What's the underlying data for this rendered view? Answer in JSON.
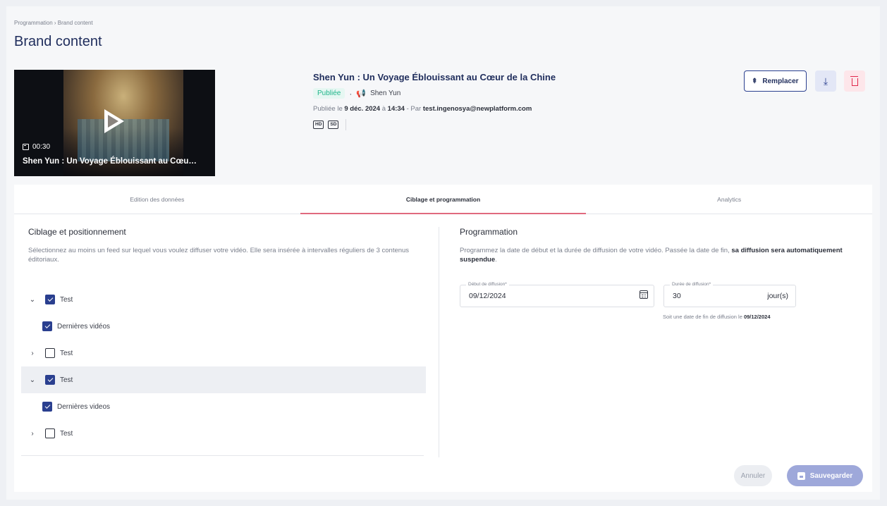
{
  "breadcrumb": "Programmation › Brand content",
  "page_title": "Brand content",
  "thumbnail": {
    "duration": "00:30",
    "title": "Shen Yun : Un Voyage Éblouissant au Cœu…"
  },
  "video": {
    "title": "Shen Yun : Un Voyage Éblouissant au Cœur de la Chine",
    "status": "Publiée",
    "separator": "·",
    "channel": "Shen Yun",
    "published_prefix": "Publiée le ",
    "published_date": "9 déc. 2024",
    "published_mid": " à ",
    "published_time": "14:34",
    "published_by_prefix": " - Par ",
    "published_by": "test.ingenosya@newplatform.com",
    "formats": [
      "HD",
      "SD"
    ]
  },
  "actions": {
    "replace_label": "Remplacer",
    "download_icon": "download-icon",
    "delete_icon": "trash-icon"
  },
  "tabs": [
    {
      "label": "Edition des données",
      "active": false
    },
    {
      "label": "Ciblage et programmation",
      "active": true
    },
    {
      "label": "Analytics",
      "active": false
    }
  ],
  "targeting": {
    "title": "Ciblage et positionnement",
    "description": "Sélectionnez au moins un feed sur lequel vous voulez diffuser votre vidéo. Elle sera insérée à intervalles réguliers de 3 contenus éditoriaux.",
    "tree": [
      {
        "label": "Test",
        "checked": true,
        "expanded": true,
        "level": 0,
        "chevron": "⌄"
      },
      {
        "label": "Dernières vidéos",
        "checked": true,
        "level": 1
      },
      {
        "label": "Test",
        "checked": false,
        "expanded": false,
        "level": 0,
        "chevron": "›"
      },
      {
        "label": "Test",
        "checked": true,
        "expanded": true,
        "level": 0,
        "chevron": "⌄",
        "highlight": true
      },
      {
        "label": "Dernières videos",
        "checked": true,
        "level": 1
      },
      {
        "label": "Test",
        "checked": false,
        "expanded": false,
        "level": 0,
        "chevron": "›"
      }
    ]
  },
  "scheduling": {
    "title": "Programmation",
    "description_start": "Programmez la date de début et la durée de diffusion de votre vidéo. Passée la date de fin, ",
    "description_bold": "sa diffusion sera automatiquement suspendue",
    "description_end": ".",
    "start_label": "Début de diffusion*",
    "start_value": "09/12/2024",
    "duration_label": "Durée de diffusion*",
    "duration_value": "30",
    "duration_unit": "jour(s)",
    "hint_prefix": "Soit une date de fin de diffusion le ",
    "hint_date": "09/12/2024"
  },
  "footer": {
    "cancel_label": "Annuler",
    "save_label": "Sauvegarder"
  }
}
